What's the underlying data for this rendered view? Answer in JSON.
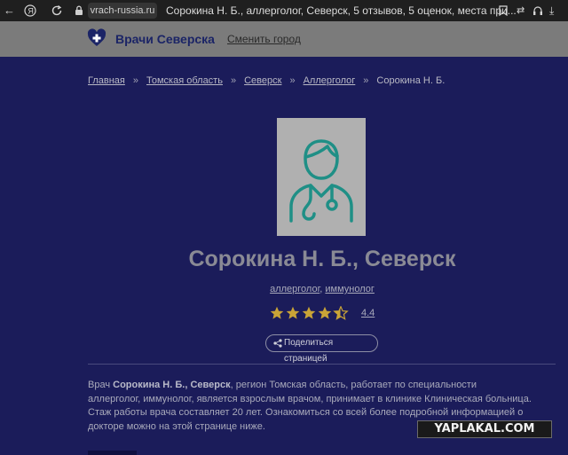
{
  "browser": {
    "url": "vrach-russia.ru",
    "tab_title": "Сорокина Н. Б., аллерголог, Северск, 5 отзывов, 5 оценок, места при...",
    "back_icon": "arrow-left-icon",
    "yandex_icon": "yandex-icon",
    "reload_icon": "reload-icon",
    "lock_icon": "lock-icon",
    "right_icons": [
      "bookmark-icon",
      "translate-icon",
      "headphones-icon",
      "download-icon",
      "extensions-icon"
    ]
  },
  "site_header": {
    "logo_text": "Врачи Северска",
    "change_city": "Сменить город",
    "logo_icon": "heart-cross-icon"
  },
  "breadcrumb": {
    "items": [
      "Главная",
      "Томская область",
      "Северск",
      "Аллерголог"
    ],
    "current": "Сорокина Н. Б.",
    "separator": "»"
  },
  "doctor": {
    "name": "Сорокина Н. Б., Северск",
    "specialty_1": "аллерголог",
    "specialty_sep": ", ",
    "specialty_2": "иммунолог",
    "rating": "4.4",
    "rating_value": 4.4,
    "rating_max": 5,
    "share_label": "Поделиться страницей",
    "avatar_icon": "doctor-avatar-icon"
  },
  "description": {
    "p1": "Врач ",
    "name_bold": "Сорокина Н. Б., Северск",
    "p2": ", регион Томская область, работает по специальности аллерголог, иммунолог, является взрослым врачом, принимает в клинике Клиническая больница. Стаж работы врача составляет 20 лет. Ознакомиться со всей более подробной информацией о докторе можно на этой странице ниже."
  },
  "watermark": "YAPLAKAL.COM",
  "colors": {
    "page_bg": "#1b1c5a",
    "header_bg": "#7b7b7b",
    "avatar_stroke": "#1f8f86",
    "star": "#c9a437"
  }
}
